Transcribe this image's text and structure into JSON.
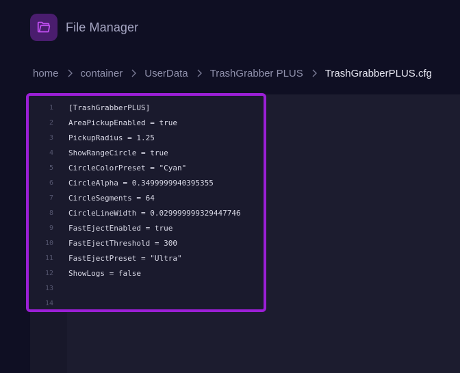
{
  "header": {
    "title": "File Manager",
    "icon": "folder-open-icon"
  },
  "breadcrumb": {
    "items": [
      "home",
      "container",
      "UserData",
      "TrashGrabber PLUS"
    ],
    "current": "TrashGrabberPLUS.cfg"
  },
  "editor": {
    "lines": [
      {
        "n": "1",
        "text": "[TrashGrabberPLUS]"
      },
      {
        "n": "2",
        "text": "AreaPickupEnabled = true"
      },
      {
        "n": "3",
        "text": "PickupRadius = 1.25"
      },
      {
        "n": "4",
        "text": "ShowRangeCircle = true"
      },
      {
        "n": "5",
        "text": "CircleColorPreset = \"Cyan\""
      },
      {
        "n": "6",
        "text": "CircleAlpha = 0.3499999940395355"
      },
      {
        "n": "7",
        "text": "CircleSegments = 64"
      },
      {
        "n": "8",
        "text": "CircleLineWidth = 0.029999999329447746"
      },
      {
        "n": "9",
        "text": "FastEjectEnabled = true"
      },
      {
        "n": "10",
        "text": "FastEjectThreshold = 300"
      },
      {
        "n": "11",
        "text": "FastEjectPreset = \"Ultra\""
      },
      {
        "n": "12",
        "text": "ShowLogs = false"
      },
      {
        "n": "13",
        "text": ""
      },
      {
        "n": "14",
        "text": ""
      }
    ]
  },
  "colors": {
    "accent": "#9b1fd6",
    "icon_bg": "#4a1d6e",
    "background": "#0f0f23"
  }
}
